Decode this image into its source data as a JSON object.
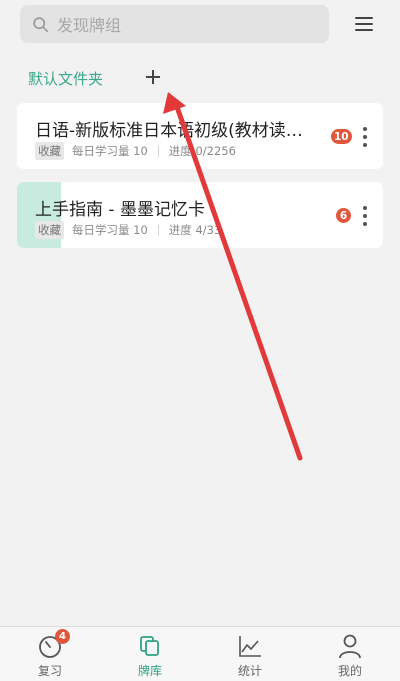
{
  "search": {
    "placeholder": "发现牌组",
    "icon": "search-icon"
  },
  "header": {
    "menu_icon": "menu-icon"
  },
  "folder": {
    "label": "默认文件夹",
    "add_icon": "plus-icon"
  },
  "decks": [
    {
      "title": "日语-新版标准日本语初级(教材读…",
      "tag": "收藏",
      "daily": "每日学习量 10",
      "progress_text": "进度 0/2256",
      "progress_fraction": 0.0,
      "due": "10"
    },
    {
      "title": "上手指南 - 墨墨记忆卡",
      "tag": "收藏",
      "daily": "每日学习量 10",
      "progress_text": "进度 4/33",
      "progress_fraction": 0.12,
      "due": "6"
    }
  ],
  "tabs": [
    {
      "label": "复习",
      "icon": "review-timer-icon",
      "badge": "4",
      "active": false
    },
    {
      "label": "牌库",
      "icon": "deck-library-icon",
      "active": true
    },
    {
      "label": "统计",
      "icon": "stats-chart-icon",
      "active": false
    },
    {
      "label": "我的",
      "icon": "profile-icon",
      "active": false
    }
  ],
  "colors": {
    "accent": "#2da383",
    "badge": "#e0573c",
    "progress": "#c8ebdf",
    "annotation_arrow": "#e23a3a"
  }
}
